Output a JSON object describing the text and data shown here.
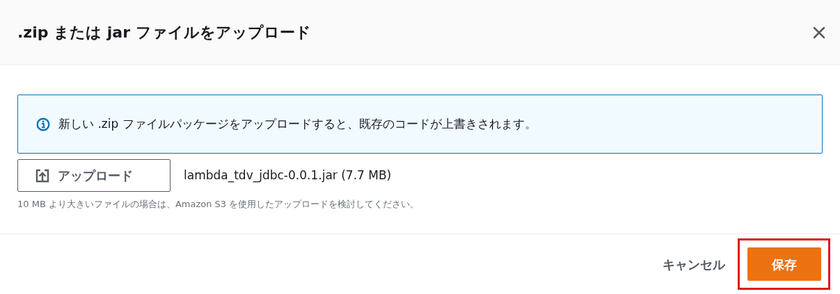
{
  "dialog": {
    "title": ".zip または jar ファイルをアップロード"
  },
  "info_alert": {
    "text": "新しい .zip ファイルパッケージをアップロードすると、既存のコードが上書きされます。"
  },
  "upload_button": {
    "label": "アップロード"
  },
  "file_name": "lambda_tdv_jdbc-0.0.1.jar (7.7 MB)",
  "hint": "10 MB より大きいファイルの場合は、Amazon S3 を使用したアップロードを検討してください。",
  "footer": {
    "cancel": "キャンセル",
    "save": {
      "label": "保存",
      "highlighted": true
    }
  }
}
